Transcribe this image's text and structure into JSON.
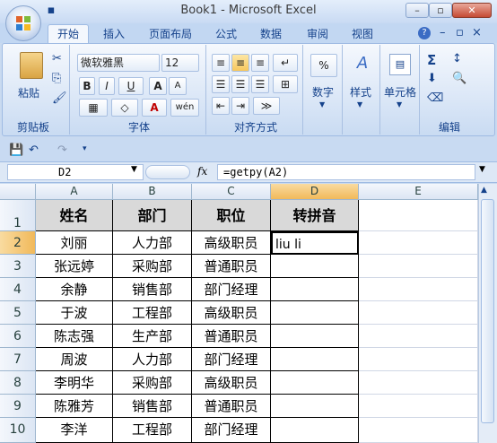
{
  "window": {
    "title": "Book1 - Microsoft Excel",
    "minimize": "–",
    "restore": "▫",
    "close": "✕"
  },
  "tabs": [
    "开始",
    "插入",
    "页面布局",
    "公式",
    "数据",
    "审阅",
    "视图"
  ],
  "ribbon": {
    "clipboard": {
      "paste": "粘贴",
      "label": "剪贴板"
    },
    "font": {
      "name": "微软雅黑",
      "size": "12",
      "bold": "B",
      "italic": "I",
      "underline": "U",
      "grow": "A",
      "shrink": "A",
      "wen": "wén",
      "color_a": "A",
      "label": "字体"
    },
    "align": {
      "label": "对齐方式"
    },
    "number": {
      "label": "数字",
      "pct": "%"
    },
    "styles": {
      "label": "样式"
    },
    "cells": {
      "label": "单元格"
    },
    "editing": {
      "label": "编辑"
    }
  },
  "formula_bar": {
    "name_box": "D2",
    "fx": "fx",
    "formula": "=getpy(A2)"
  },
  "sheet": {
    "columns": [
      "A",
      "B",
      "C",
      "D",
      "E"
    ],
    "rows": [
      "1",
      "2",
      "3",
      "4",
      "5",
      "6",
      "7",
      "8",
      "9",
      "10"
    ],
    "header": [
      "姓名",
      "部门",
      "职位",
      "转拼音"
    ],
    "data": [
      [
        "刘丽",
        "人力部",
        "高级职员",
        "liu li"
      ],
      [
        "张远婷",
        "采购部",
        "普通职员",
        ""
      ],
      [
        "余静",
        "销售部",
        "部门经理",
        ""
      ],
      [
        "于波",
        "工程部",
        "高级职员",
        ""
      ],
      [
        "陈志强",
        "生产部",
        "普通职员",
        ""
      ],
      [
        "周波",
        "人力部",
        "部门经理",
        ""
      ],
      [
        "李明华",
        "采购部",
        "高级职员",
        ""
      ],
      [
        "陈雅芳",
        "销售部",
        "普通职员",
        ""
      ],
      [
        "李洋",
        "工程部",
        "部门经理",
        ""
      ]
    ]
  }
}
